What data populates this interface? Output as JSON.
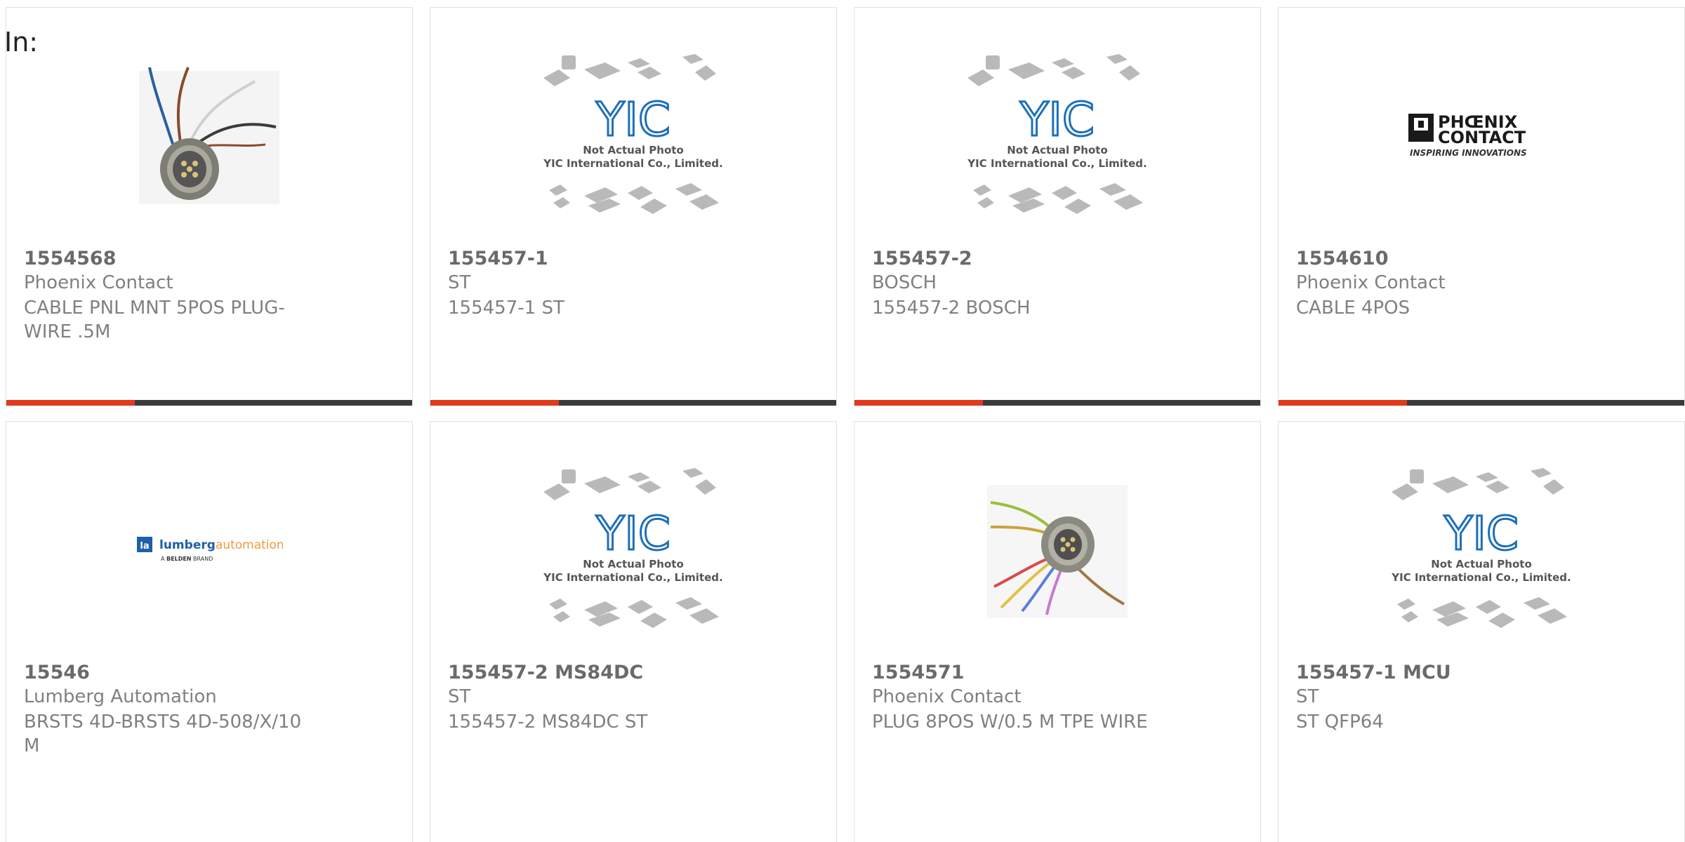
{
  "filter_label": "In:",
  "products": [
    {
      "part_number": "1554568",
      "manufacturer": "Phoenix Contact",
      "description": "CABLE PNL MNT 5POS PLUG-WIRE .5M",
      "image": "connector-wires-photo"
    },
    {
      "part_number": "155457-1",
      "manufacturer": "ST",
      "description": "155457-1 ST",
      "image": "yic-placeholder"
    },
    {
      "part_number": "155457-2",
      "manufacturer": "BOSCH",
      "description": "155457-2 BOSCH",
      "image": "yic-placeholder"
    },
    {
      "part_number": "1554610",
      "manufacturer": "Phoenix Contact",
      "description": "CABLE 4POS",
      "image": "phoenix-contact-logo"
    },
    {
      "part_number": "15546",
      "manufacturer": "Lumberg Automation",
      "description": "BRSTS 4D-BRSTS 4D-508/X/10 M",
      "image": "lumberg-automation-logo"
    },
    {
      "part_number": "155457-2 MS84DC",
      "manufacturer": "ST",
      "description": "155457-2 MS84DC ST",
      "image": "yic-placeholder"
    },
    {
      "part_number": "1554571",
      "manufacturer": "Phoenix Contact",
      "description": "PLUG 8POS W/0.5 M TPE WIRE",
      "image": "connector-colored-wires-photo"
    },
    {
      "part_number": "155457-1 MCU",
      "manufacturer": "ST",
      "description": "ST QFP64",
      "image": "yic-placeholder"
    }
  ],
  "placeholder": {
    "brand": "YIC",
    "line1": "Not Actual Photo",
    "line2": "YIC International Co., Limited."
  },
  "logos": {
    "phoenix_line1": "PHŒNIX",
    "phoenix_line2": "CONTACT",
    "phoenix_tagline": "INSPIRING INNOVATIONS",
    "lumberg_mark": "la",
    "lumberg_name_a": "lumberg",
    "lumberg_name_b": "automation",
    "lumberg_sub_a": "A",
    "lumberg_sub_b": "BELDEN",
    "lumberg_sub_c": "BRAND"
  },
  "colors": {
    "accent": "#e2391a",
    "bar": "#3b3b3b",
    "yic_blue": "#1e6fb8"
  }
}
